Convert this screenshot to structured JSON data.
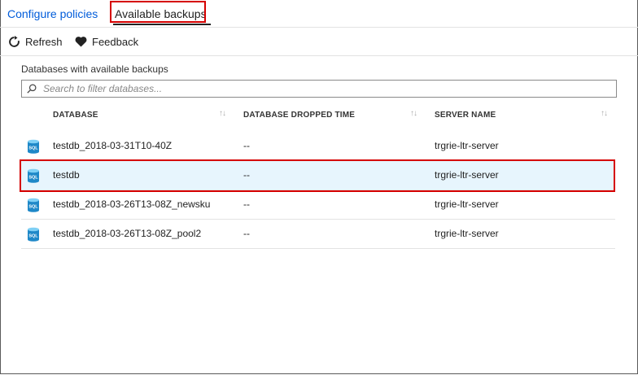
{
  "tabs": [
    {
      "label": "Configure policies",
      "active": false
    },
    {
      "label": "Available backups",
      "active": true
    }
  ],
  "toolbar": {
    "refresh_label": "Refresh",
    "refresh_icon": "refresh-icon",
    "feedback_label": "Feedback",
    "feedback_icon": "heart-icon"
  },
  "main": {
    "section_label": "Databases with available backups",
    "search": {
      "placeholder": "Search to filter databases...",
      "value": "",
      "icon": "search-icon"
    },
    "columns": [
      "DATABASE",
      "DATABASE DROPPED TIME",
      "SERVER NAME"
    ],
    "rows": [
      {
        "database": "testdb_2018-03-31T10-40Z",
        "dropped_time": "--",
        "server": "trgrie-ltr-server",
        "selected": false
      },
      {
        "database": "testdb",
        "dropped_time": "--",
        "server": "trgrie-ltr-server",
        "selected": true
      },
      {
        "database": "testdb_2018-03-26T13-08Z_newsku",
        "dropped_time": "--",
        "server": "trgrie-ltr-server",
        "selected": false
      },
      {
        "database": "testdb_2018-03-26T13-08Z_pool2",
        "dropped_time": "--",
        "server": "trgrie-ltr-server",
        "selected": false
      }
    ],
    "row_icon": "sql-database-icon",
    "row_icon_text": "SQL"
  },
  "colors": {
    "link_blue": "#015cda",
    "selected_row": "#e7f5fd",
    "highlight_red": "#d50000",
    "sql_icon_blue": "#1e88c8"
  }
}
